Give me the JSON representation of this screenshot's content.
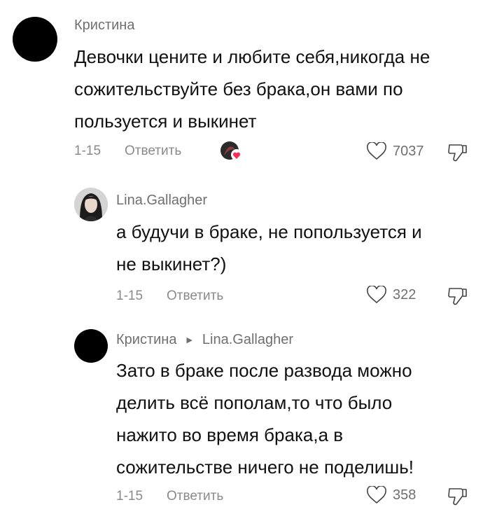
{
  "comments": [
    {
      "author": "Кристина",
      "text_lines": [
        "Девочки цените и любите себя,никогда не",
        "сожительствуйте без брака,он вами по",
        "пользуется и выкинет"
      ],
      "date": "1-15",
      "reply_label": "Ответить",
      "likes": "7037",
      "creator_liked": true
    },
    {
      "author": "Lina.Gallagher",
      "text_lines": [
        "а будучи в браке, не попользуется и",
        "не выкинет?)"
      ],
      "date": "1-15",
      "reply_label": "Ответить",
      "likes": "322"
    },
    {
      "author": "Кристина",
      "reply_to": "Lina.Gallagher",
      "text_lines": [
        "Зато в браке после развода можно",
        "делить всё пополам,то что было",
        "нажито во время брака,а в",
        "сожительстве ничего не поделишь!"
      ],
      "date": "1-15",
      "reply_label": "Ответить",
      "likes": "358"
    }
  ],
  "colors": {
    "text": "#111111",
    "muted": "#8a8a8a",
    "heart_badge": "#fe2c55"
  },
  "icons": [
    "heart-outline-icon",
    "dislike-icon",
    "creator-liked-badge-icon",
    "reply-arrow-icon"
  ]
}
